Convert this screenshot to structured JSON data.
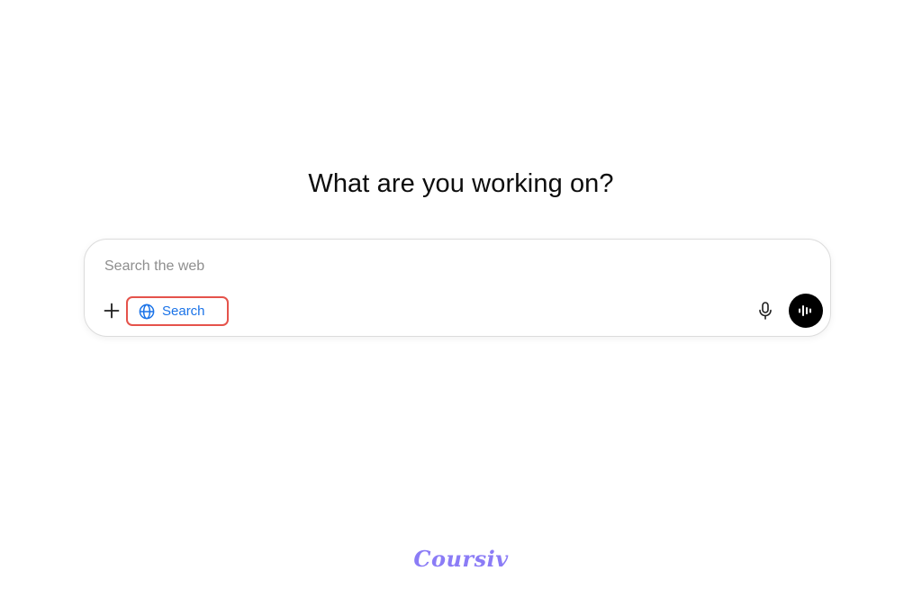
{
  "heading": "What are you working on?",
  "composer": {
    "placeholder": "Search the web",
    "value": "",
    "search_toggle_label": "Search"
  },
  "icons": {
    "plus": "plus-icon",
    "globe": "globe-icon",
    "mic": "microphone-icon",
    "voice": "voice-waveform-icon"
  },
  "colors": {
    "search_label": "#1a73e8",
    "highlight_border": "#e5534b",
    "voice_button": "#000000",
    "logo": "#8b7cf6"
  },
  "footer": {
    "logo_text": "Coursiv"
  }
}
